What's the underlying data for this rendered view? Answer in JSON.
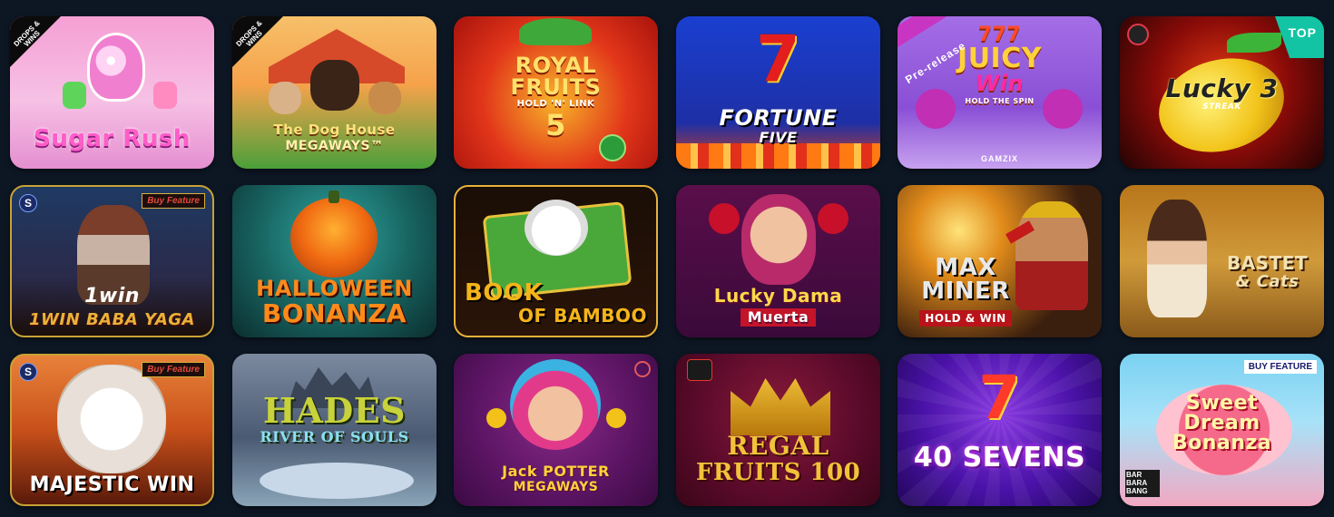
{
  "tiles": [
    {
      "title_lines": [
        "Sugar Rush"
      ],
      "badge": "DROPS & WINS"
    },
    {
      "title_lines": [
        "The Dog House",
        "MEGAWAYS™"
      ],
      "badge": "DROPS & WINS"
    },
    {
      "title_lines": [
        "ROYAL",
        "FRUITS",
        "HOLD 'N' LINK",
        "5"
      ]
    },
    {
      "title_lines": [
        "7",
        "FORTUNE",
        "FIVE"
      ]
    },
    {
      "title_lines": [
        "777",
        "JUICY",
        "Win",
        "HOLD THE SPIN"
      ],
      "ribbon": "Pre-release",
      "provider": "GAMZIX"
    },
    {
      "title_lines": [
        "Lucky 3",
        "STREAK"
      ],
      "top_badge": "TOP"
    },
    {
      "title_lines": [
        "1win",
        "1WIN BABA YAGA"
      ],
      "buy_badge": "Buy Feature",
      "s_badge": "S"
    },
    {
      "title_lines": [
        "HALLOWEEN",
        "BONANZA"
      ]
    },
    {
      "title_lines": [
        "BOOK",
        "OF BAMBOO"
      ]
    },
    {
      "title_lines": [
        "Lucky Dama",
        "Muerta"
      ]
    },
    {
      "title_lines": [
        "MAX",
        "MINER",
        "HOLD & WIN"
      ]
    },
    {
      "title_lines": [
        "BASTET",
        "& Cats"
      ]
    },
    {
      "title_lines": [
        "MAJESTIC WIN"
      ],
      "buy_badge": "Buy Feature",
      "s_badge": "S"
    },
    {
      "title_lines": [
        "HADES",
        "RIVER OF SOULS"
      ]
    },
    {
      "title_lines": [
        "Jack POTTER",
        "MEGAWAYS"
      ]
    },
    {
      "title_lines": [
        "REGAL",
        "FRUITS 100"
      ]
    },
    {
      "title_lines": [
        "7",
        "40 SEVENS"
      ]
    },
    {
      "title_lines": [
        "Sweet",
        "Dream",
        "Bonanza"
      ],
      "buy_badge": "BUY FEATURE",
      "provider": "BAR BARA BANG"
    }
  ],
  "colors": {
    "page_background": "#0d1623"
  }
}
